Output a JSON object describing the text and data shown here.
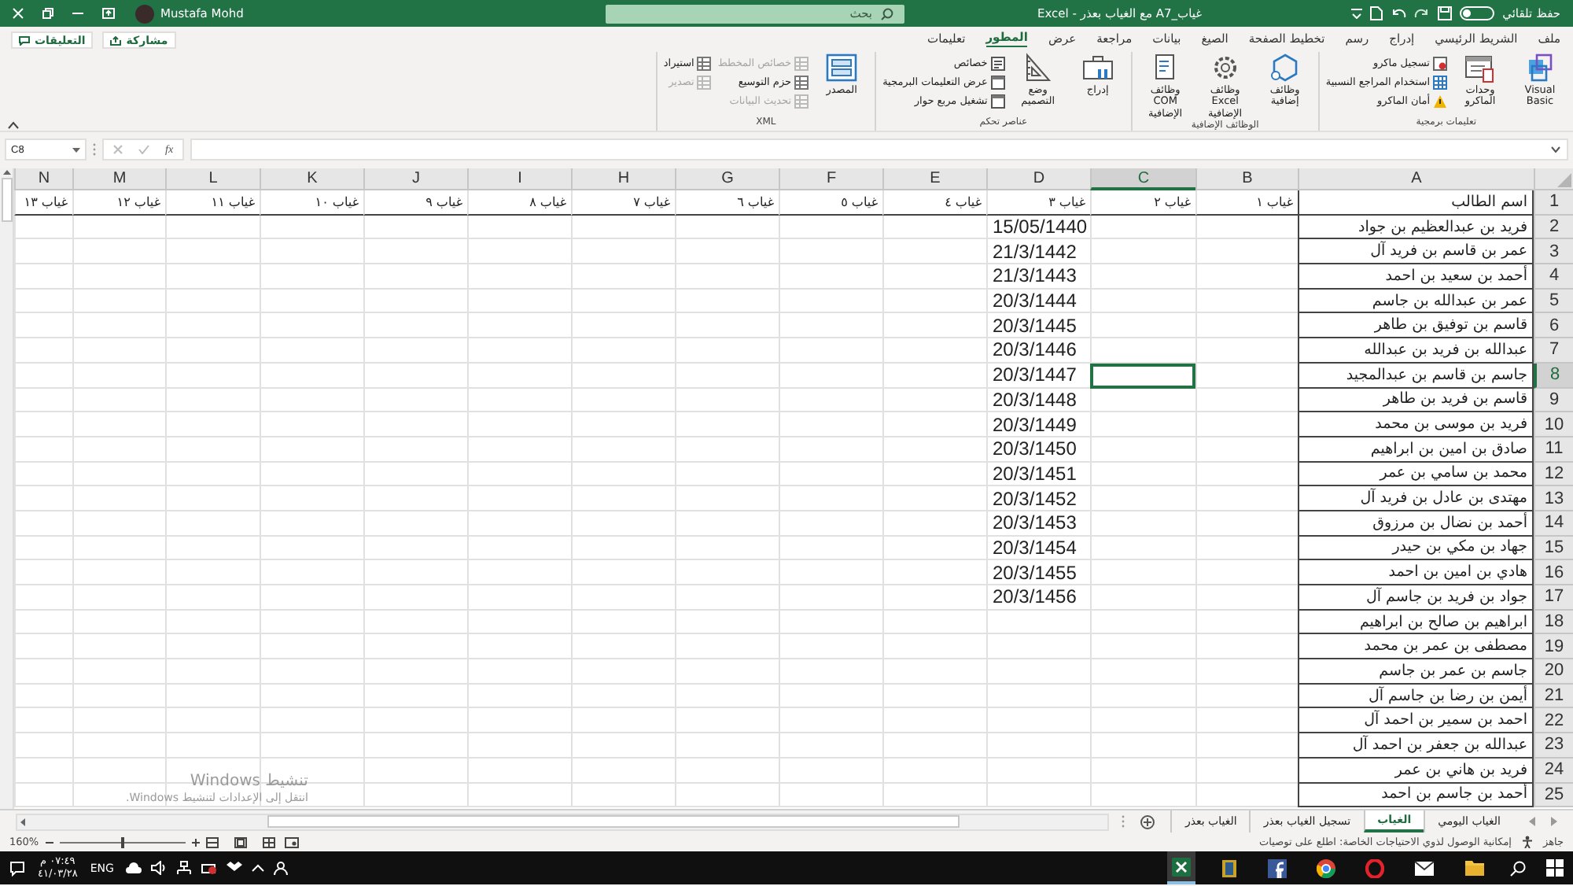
{
  "title_bar": {
    "autosave": {
      "label": "حفظ تلقائي",
      "on": false
    },
    "document_title": "غياب_A7 مع الغياب بعذر  -  Excel",
    "search": {
      "placeholder": "بحث"
    },
    "user_name": "Mustafa Mohd"
  },
  "ribbon": {
    "tabs": [
      {
        "label": "ملف",
        "selected": false
      },
      {
        "label": "الشريط الرئيسي",
        "selected": false
      },
      {
        "label": "إدراج",
        "selected": false
      },
      {
        "label": "رسم",
        "selected": false
      },
      {
        "label": "تخطيط الصفحة",
        "selected": false
      },
      {
        "label": "الصيغ",
        "selected": false
      },
      {
        "label": "بيانات",
        "selected": false
      },
      {
        "label": "مراجعة",
        "selected": false
      },
      {
        "label": "عرض",
        "selected": false
      },
      {
        "label": "المطور",
        "selected": true
      },
      {
        "label": "تعليمات",
        "selected": false
      }
    ],
    "share_button": "مشاركة",
    "comments_button": "التعليقات",
    "groups": [
      {
        "label": "تعليمات برمجية",
        "items": [
          {
            "kind": "large",
            "label": "Visual Basic",
            "disabled": false
          },
          {
            "kind": "large",
            "label": "وحدات الماكرو",
            "disabled": false
          },
          {
            "kind": "small",
            "label": "تسجيل ماكرو",
            "disabled": false
          },
          {
            "kind": "small",
            "label": "استخدام المراجع النسبية",
            "disabled": false
          },
          {
            "kind": "small",
            "label": "أمان الماكرو",
            "disabled": false
          }
        ]
      },
      {
        "label": "الوظائف الإضافية",
        "items": [
          {
            "kind": "large",
            "label": "وظائف إضافية",
            "disabled": false
          },
          {
            "kind": "large",
            "label": "وظائف Excel الإضافية",
            "disabled": false
          },
          {
            "kind": "large",
            "label": "وظائف COM الإضافية",
            "disabled": false
          }
        ]
      },
      {
        "label": "عناصر تحكم",
        "items": [
          {
            "kind": "large",
            "label": "إدراج",
            "disabled": false
          },
          {
            "kind": "large",
            "label": "وضع التصميم",
            "disabled": false
          },
          {
            "kind": "small",
            "label": "خصائص",
            "disabled": false
          },
          {
            "kind": "small",
            "label": "عرض التعليمات البرمجية",
            "disabled": false
          },
          {
            "kind": "small",
            "label": "تشغيل مربع حوار",
            "disabled": false
          }
        ]
      },
      {
        "label": "XML",
        "items": [
          {
            "kind": "large",
            "label": "المصدر",
            "disabled": false
          },
          {
            "kind": "small",
            "label": "خصائص المخطط",
            "disabled": true
          },
          {
            "kind": "small",
            "label": "حزم التوسيع",
            "disabled": false
          },
          {
            "kind": "small",
            "label": "تحديث البيانات",
            "disabled": true
          },
          {
            "kind": "small",
            "label": "استيراد",
            "disabled": false
          },
          {
            "kind": "small",
            "label": "تصدير",
            "disabled": true
          }
        ]
      }
    ]
  },
  "formula_bar": {
    "name_box": "C8",
    "function_label": "fx"
  },
  "sheet": {
    "columns": [
      {
        "label": "A",
        "selected": false
      },
      {
        "label": "B",
        "selected": false
      },
      {
        "label": "C",
        "selected": true
      },
      {
        "label": "D",
        "selected": false
      },
      {
        "label": "E",
        "selected": false
      },
      {
        "label": "F",
        "selected": false
      },
      {
        "label": "G",
        "selected": false
      },
      {
        "label": "H",
        "selected": false
      },
      {
        "label": "I",
        "selected": false
      },
      {
        "label": "J",
        "selected": false
      },
      {
        "label": "K",
        "selected": false
      },
      {
        "label": "L",
        "selected": false
      },
      {
        "label": "M",
        "selected": false
      },
      {
        "label": "N",
        "selected": false
      }
    ],
    "rows": [
      {
        "number": "1",
        "selected": false,
        "cells": [
          "اسم الطالب",
          "غياب ١",
          "غياب ٢",
          "غياب ٣",
          "غياب ٤",
          "غياب ٥",
          "غياب ٦",
          "غياب ٧",
          "غياب ٨",
          "غياب ٩",
          "غياب ١٠",
          "غياب ١١",
          "غياب ١٢",
          "غياب ١٣"
        ]
      },
      {
        "number": "2",
        "selected": false,
        "name": "فريد بن عبدالعظيم بن جواد",
        "date": "15/05/1440"
      },
      {
        "number": "3",
        "selected": false,
        "name": "عمر بن قاسم بن فريد آل",
        "date": "21/3/1442"
      },
      {
        "number": "4",
        "selected": false,
        "name": "أحمد بن سعيد بن احمد",
        "date": "21/3/1443"
      },
      {
        "number": "5",
        "selected": false,
        "name": "عمر بن عبدالله بن جاسم",
        "date": "20/3/1444"
      },
      {
        "number": "6",
        "selected": false,
        "name": "قاسم بن توفيق بن طاهر",
        "date": "20/3/1445"
      },
      {
        "number": "7",
        "selected": false,
        "name": "عبدالله بن فريد بن عبدالله",
        "date": "20/3/1446"
      },
      {
        "number": "8",
        "selected": true,
        "name": "جاسم بن قاسم بن عبدالمجيد",
        "date": "20/3/1447"
      },
      {
        "number": "9",
        "selected": false,
        "name": "قاسم بن فريد بن طاهر",
        "date": "20/3/1448"
      },
      {
        "number": "10",
        "selected": false,
        "name": "فريد بن موسى بن محمد",
        "date": "20/3/1449"
      },
      {
        "number": "11",
        "selected": false,
        "name": "صادق بن امين بن ابراهيم",
        "date": "20/3/1450"
      },
      {
        "number": "12",
        "selected": false,
        "name": "محمد بن سامي بن عمر",
        "date": "20/3/1451"
      },
      {
        "number": "13",
        "selected": false,
        "name": "مهتدى بن عادل بن فريد آل",
        "date": "20/3/1452"
      },
      {
        "number": "14",
        "selected": false,
        "name": "أحمد بن نضال بن مرزوق",
        "date": "20/3/1453"
      },
      {
        "number": "15",
        "selected": false,
        "name": "جهاد بن مكي بن حيدر",
        "date": "20/3/1454"
      },
      {
        "number": "16",
        "selected": false,
        "name": "هادي بن امين بن احمد",
        "date": "20/3/1455"
      },
      {
        "number": "17",
        "selected": false,
        "name": "جواد بن فريد بن جاسم آل",
        "date": "20/3/1456"
      },
      {
        "number": "18",
        "selected": false,
        "name": "ابراهيم بن صالح بن ابراهيم"
      },
      {
        "number": "19",
        "selected": false,
        "name": "مصطفى بن عمر بن محمد"
      },
      {
        "number": "20",
        "selected": false,
        "name": "جاسم بن عمر بن جاسم"
      },
      {
        "number": "21",
        "selected": false,
        "name": "أيمن بن رضا بن جاسم آل"
      },
      {
        "number": "22",
        "selected": false,
        "name": "احمد بن سمير بن احمد آل"
      },
      {
        "number": "23",
        "selected": false,
        "name": "عبدالله بن جعفر بن احمد آل"
      },
      {
        "number": "24",
        "selected": false,
        "name": "فريد بن هاني بن عمر"
      },
      {
        "number": "25",
        "selected": false,
        "name": "أحمد بن جاسم بن احمد"
      }
    ]
  },
  "activation_notice": {
    "title": "تنشيط Windows",
    "message": "انتقل إلى الإعدادات لتنشيط Windows."
  },
  "sheet_tabs": [
    {
      "label": "الغياب اليومي",
      "selected": false
    },
    {
      "label": "الغياب",
      "selected": true
    },
    {
      "label": "تسجيل الغياب بعذر",
      "selected": false
    },
    {
      "label": "الغياب بعذر",
      "selected": false
    }
  ],
  "status_bar": {
    "mode": "جاهز",
    "accessibility": "إمكانية الوصول لذوي الاحتياجات الخاصة: اطلع على توصيات",
    "zoom": {
      "reading": "160%",
      "level": 0.5
    }
  },
  "taskbar": {
    "language": "ENG",
    "time": "٠٧:٤٩ م",
    "date": "٤١/٠٣/٢٨"
  }
}
